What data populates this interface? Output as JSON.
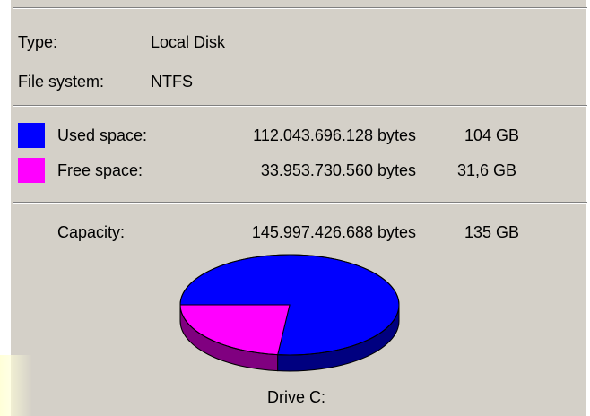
{
  "properties": {
    "type_label": "Type:",
    "type_value": "Local Disk",
    "fs_label": "File system:",
    "fs_value": "NTFS"
  },
  "usage": {
    "used": {
      "label": "Used space:",
      "bytes": "112.043.696.128 bytes",
      "size": "104 GB",
      "color": "#0000ff"
    },
    "free": {
      "label": "Free space:",
      "bytes": "33.953.730.560 bytes",
      "size": "31,6 GB",
      "color": "#ff00ff"
    },
    "capacity": {
      "label": "Capacity:",
      "bytes": "145.997.426.688 bytes",
      "size": "135 GB"
    }
  },
  "chart": {
    "drive_label": "Drive C:",
    "used_fraction": 0.7674,
    "free_fraction": 0.2326,
    "used_dark_color": "#000080",
    "free_dark_color": "#800080"
  }
}
